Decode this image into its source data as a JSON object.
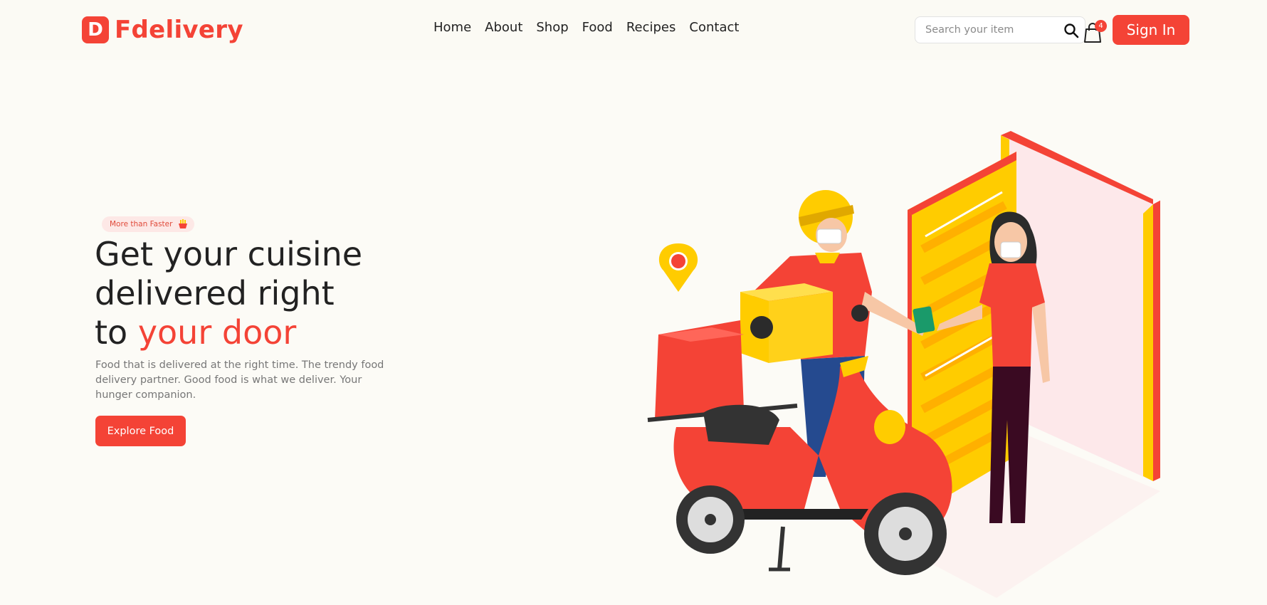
{
  "brand": {
    "logo_letter": "D",
    "name": "Fdelivery"
  },
  "nav": {
    "items": [
      {
        "label": "Home"
      },
      {
        "label": "About"
      },
      {
        "label": "Shop"
      },
      {
        "label": "Food"
      },
      {
        "label": "Recipes"
      },
      {
        "label": "Contact"
      }
    ]
  },
  "search": {
    "placeholder": "Search your item",
    "value": "",
    "icon": "search-icon"
  },
  "cart": {
    "icon": "shopping-bag-icon",
    "count": "4"
  },
  "signin": {
    "label": "Sign In"
  },
  "hero": {
    "badge": {
      "text": "More than Faster",
      "icon": "fries-icon"
    },
    "title": {
      "line1": "Get your cuisine",
      "line2": "delivered right",
      "line3_prefix": "to ",
      "line3_accent": "your door"
    },
    "description": "Food that is delivered at the right time. The trendy food delivery partner. Good food is what we deliver. Your hunger companion.",
    "cta_label": "Explore Food",
    "illustration": "delivery-scooter-illustration"
  },
  "colors": {
    "accent": "#f44336",
    "background": "#fcfbf6",
    "yellow": "#ffcc00",
    "badge_bg": "#fde8e6"
  }
}
